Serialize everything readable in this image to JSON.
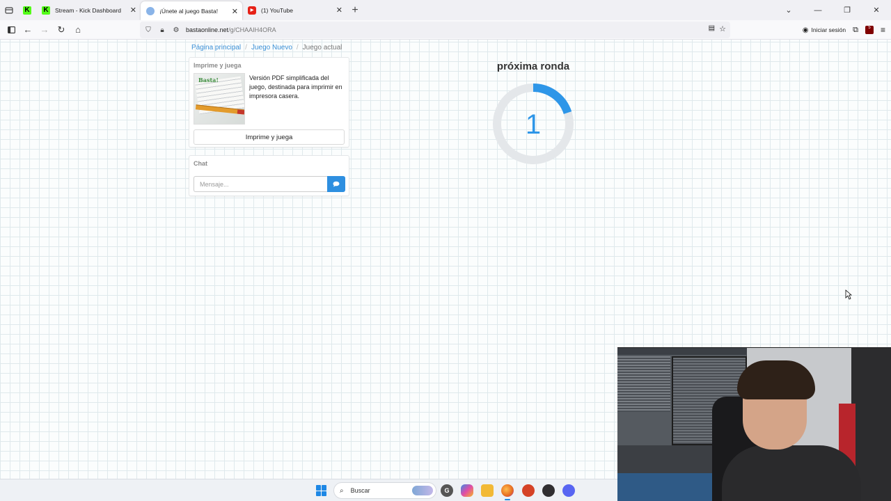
{
  "browser": {
    "tabs": [
      {
        "title": "",
        "favicon": "kick-icon",
        "color": "#53fc18"
      },
      {
        "title": "Stream - Kick Dashboard",
        "favicon": "kick-icon",
        "color": "#53fc18"
      },
      {
        "title": "¡Únete al juego Basta!",
        "favicon": "globe-icon",
        "color": "#8ab4e8",
        "active": true
      },
      {
        "title": "(1) YouTube",
        "favicon": "youtube-icon",
        "color": "#e62117"
      }
    ],
    "url_host": "bastaonline.net",
    "url_path": "/g/CHAAIH4ORA",
    "signin_label": "Iniciar sesión",
    "extension_badge": "5"
  },
  "breadcrumb": {
    "home": "Página principal",
    "new_game": "Juego Nuevo",
    "current": "Juego actual"
  },
  "print_panel": {
    "heading": "Imprime y juega",
    "description": "Versión PDF simplificada del juego, destinada para imprimir en impresora casera.",
    "button_label": "Imprime y juega",
    "thumb_logo": "Basta!"
  },
  "chat_panel": {
    "heading": "Chat",
    "input_placeholder": "Mensaje..."
  },
  "countdown": {
    "title": "próxima ronda",
    "value": "1",
    "progress_fraction": 0.2,
    "ring_color": "#2e96e8",
    "track_color": "#e4e7ea"
  },
  "taskbar": {
    "search_label": "Buscar",
    "apps": [
      {
        "name": "copilot-icon",
        "color": "#555"
      },
      {
        "name": "colors-icon",
        "color": "#8c6fe0"
      },
      {
        "name": "file-explorer-icon",
        "color": "#f2b935"
      },
      {
        "name": "firefox-icon",
        "color": "#e66b1f"
      },
      {
        "name": "brave-icon",
        "color": "#d54226"
      },
      {
        "name": "obs-icon",
        "color": "#302e31"
      },
      {
        "name": "discord-icon",
        "color": "#5865f2"
      }
    ]
  }
}
